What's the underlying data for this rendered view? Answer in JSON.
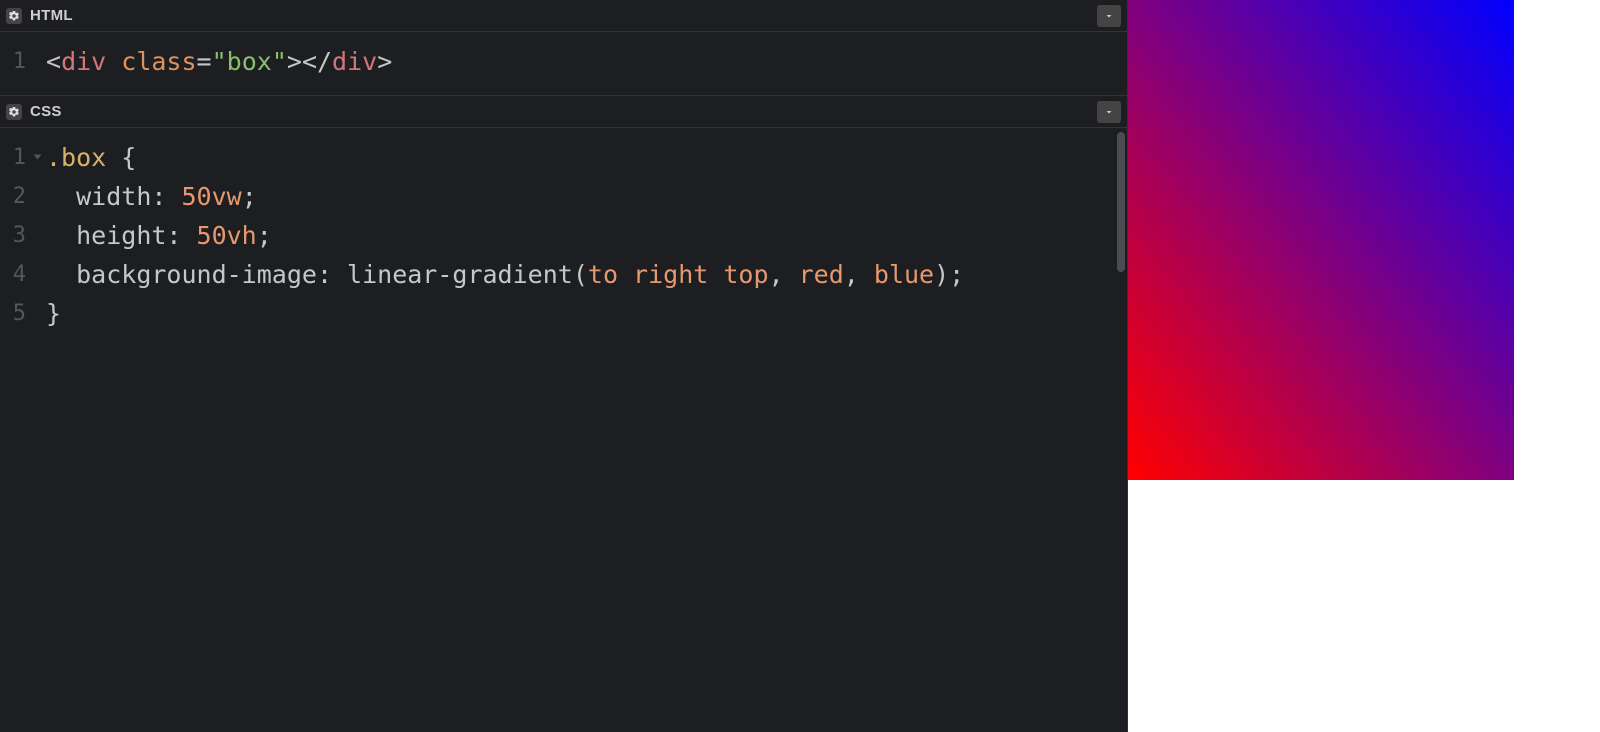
{
  "panels": {
    "html": {
      "title": "HTML",
      "lines": [
        "1"
      ],
      "code_tokens": [
        [
          {
            "t": "<",
            "c": "punct"
          },
          {
            "t": "div",
            "c": "tag"
          },
          {
            "t": " ",
            "c": "punct"
          },
          {
            "t": "class",
            "c": "attr"
          },
          {
            "t": "=",
            "c": "punct"
          },
          {
            "t": "\"box\"",
            "c": "str"
          },
          {
            "t": ">",
            "c": "punct"
          },
          {
            "t": "</",
            "c": "punct"
          },
          {
            "t": "div",
            "c": "tag"
          },
          {
            "t": ">",
            "c": "punct"
          }
        ]
      ]
    },
    "css": {
      "title": "CSS",
      "lines": [
        "1",
        "2",
        "3",
        "4",
        "5"
      ],
      "fold_lines": [
        0
      ],
      "code_tokens": [
        [
          {
            "t": ".box",
            "c": "sel"
          },
          {
            "t": " {",
            "c": "punct"
          }
        ],
        [
          {
            "t": "  ",
            "c": "punct"
          },
          {
            "t": "width",
            "c": "prop"
          },
          {
            "t": ": ",
            "c": "punct"
          },
          {
            "t": "50vw",
            "c": "val"
          },
          {
            "t": ";",
            "c": "punct"
          }
        ],
        [
          {
            "t": "  ",
            "c": "punct"
          },
          {
            "t": "height",
            "c": "prop"
          },
          {
            "t": ": ",
            "c": "punct"
          },
          {
            "t": "50vh",
            "c": "val"
          },
          {
            "t": ";",
            "c": "punct"
          }
        ],
        [
          {
            "t": "  ",
            "c": "punct"
          },
          {
            "t": "background-image",
            "c": "prop"
          },
          {
            "t": ": ",
            "c": "punct"
          },
          {
            "t": "linear-gradient",
            "c": "fn"
          },
          {
            "t": "(",
            "c": "punct"
          },
          {
            "t": "to right top",
            "c": "val"
          },
          {
            "t": ", ",
            "c": "punct"
          },
          {
            "t": "red",
            "c": "val"
          },
          {
            "t": ", ",
            "c": "punct"
          },
          {
            "t": "blue",
            "c": "val"
          },
          {
            "t": ")",
            "c": "punct"
          },
          {
            "t": ";",
            "c": "punct"
          }
        ],
        [
          {
            "t": "}",
            "c": "punct"
          }
        ]
      ]
    }
  },
  "preview": {
    "gradient_from": "red",
    "gradient_to": "blue",
    "gradient_direction": "to right top"
  },
  "icons": {
    "gear": "gear-icon",
    "chevron": "chevron-down-icon"
  }
}
